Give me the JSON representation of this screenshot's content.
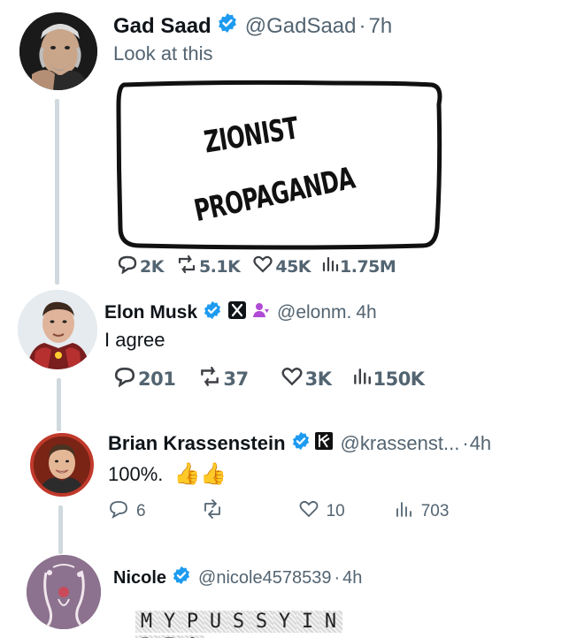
{
  "tweets": [
    {
      "name": "Gad Saad",
      "handle": "@GadSaad",
      "time": "7h",
      "text": "Look at this",
      "image_text": [
        "ZIONIST",
        "PROPAGANDA"
      ],
      "stats": {
        "replies": "2K",
        "retweets": "5.1K",
        "likes": "45K",
        "views": "1.75M"
      }
    },
    {
      "name": "Elon Musk",
      "handle": "@elonm.",
      "time": "4h",
      "text": "I agree",
      "stats": {
        "replies": "201",
        "retweets": "37",
        "likes": "3K",
        "views": "150K"
      }
    },
    {
      "name": "Brian Krassenstein",
      "handle": "@krassenst...",
      "time": "4h",
      "text": "100%.",
      "emoji": "👍👍",
      "stats": {
        "replies": "6",
        "retweets": "",
        "likes": "10",
        "views": "703"
      }
    },
    {
      "name": "Nicole",
      "handle": "@nicole4578539",
      "time": "4h",
      "bio_line1": [
        "M",
        "Y",
        "P",
        "U",
        "S",
        "S",
        "Y",
        "I",
        "N"
      ],
      "bio_line2": [
        "B",
        "I",
        "O"
      ]
    }
  ],
  "separator": "·",
  "colors": {
    "verified_blue": "#1d9bf0",
    "text": "#0f1419",
    "muted": "#536471",
    "thread": "#cfd9de"
  },
  "icons": [
    "verified-badge-icon",
    "x-logo-icon",
    "admin-badge-icon",
    "kraken-logo-icon",
    "reply-icon",
    "retweet-icon",
    "like-icon",
    "views-icon"
  ]
}
